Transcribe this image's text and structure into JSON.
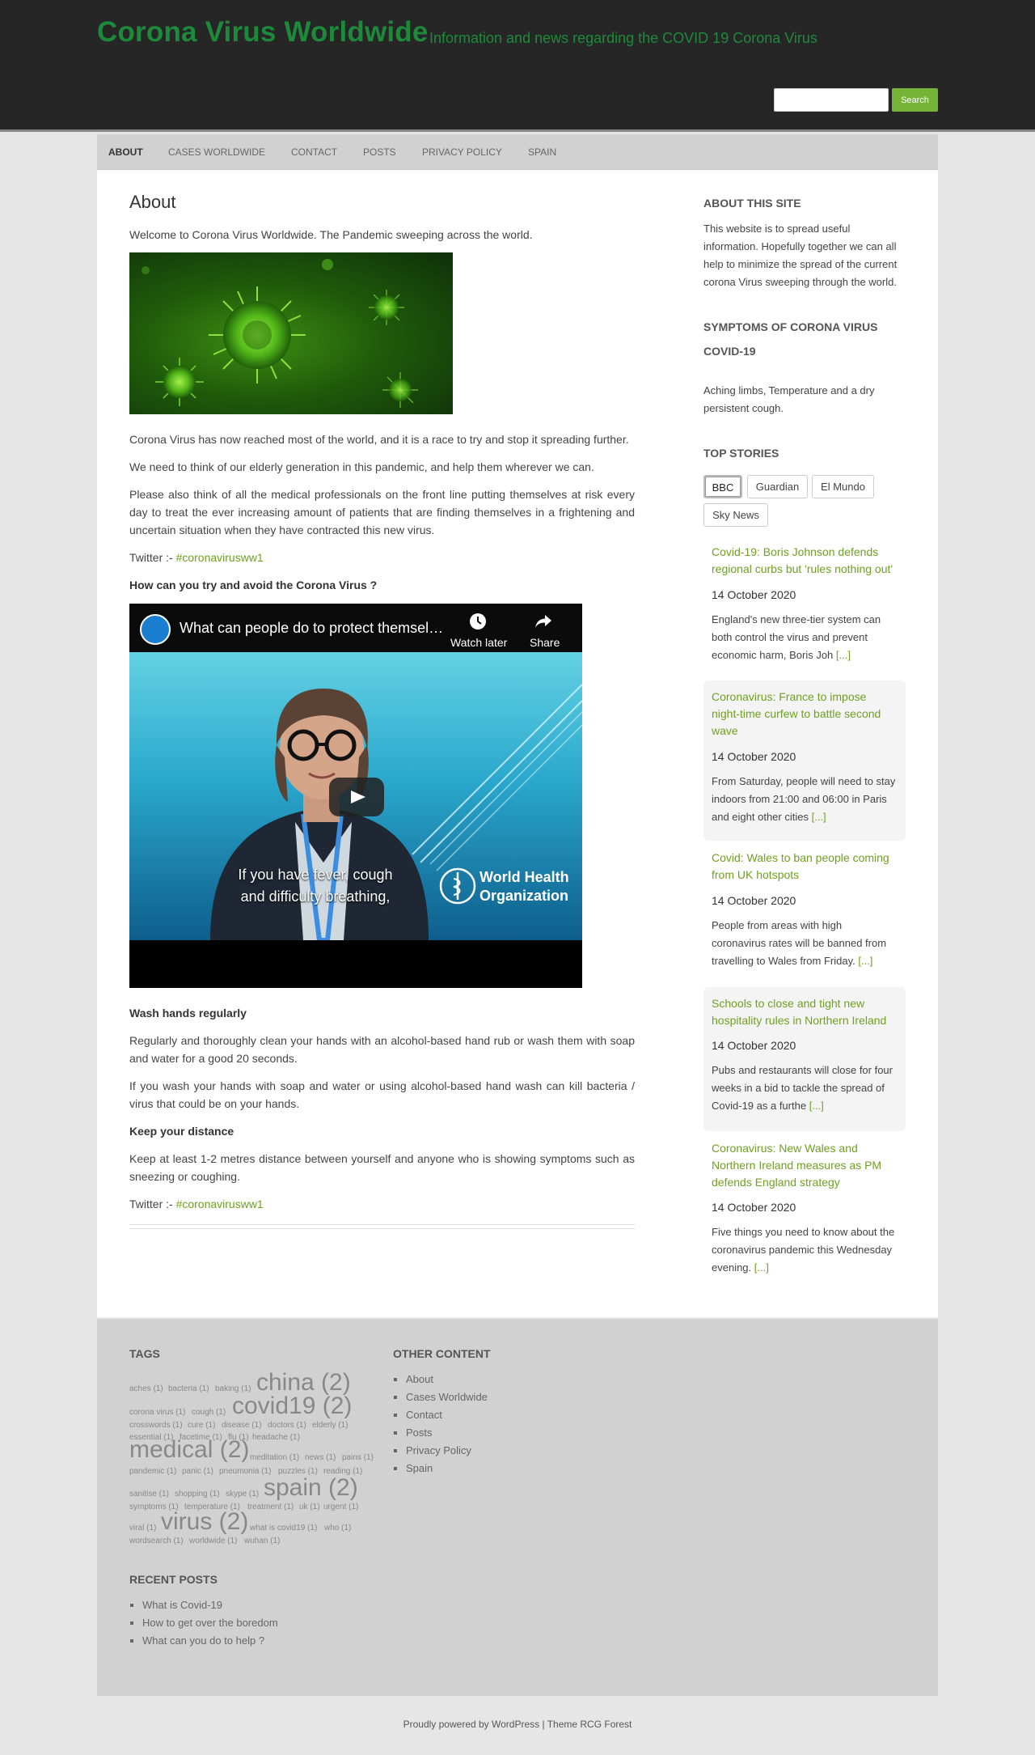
{
  "header": {
    "site_title": "Corona Virus Worldwide",
    "site_description": "Information and news regarding the COVID 19 Corona Virus",
    "search_button": "Search"
  },
  "nav": [
    "ABOUT",
    "CASES WORLDWIDE",
    "CONTACT",
    "POSTS",
    "PRIVACY POLICY",
    "SPAIN"
  ],
  "main": {
    "title": "About",
    "intro": "Welcome to Corona Virus Worldwide. The Pandemic sweeping across the world.",
    "p1": "Corona Virus has now reached most of the world, and it is a race to try and stop it spreading further.",
    "p2": "We need to think of our elderly generation in this pandemic, and help them wherever we can.",
    "p3": "Please also think of all the medical professionals on the front line putting themselves at risk every day to treat the ever increasing amount of patients that are finding themselves in a frightening and uncertain situation when they have contracted this new virus.",
    "twitter_label": "Twitter :-",
    "twitter_handle": "#coronavirusww1",
    "avoid_heading": "How can you try and avoid the Corona Virus ?",
    "video": {
      "title": "What can people do to protect themsel…",
      "watch_later": "Watch later",
      "share": "Share",
      "caption_line1": "If you have fever, cough",
      "caption_line2": "and difficulty breathing,",
      "org_line1": "World Health",
      "org_line2": "Organization"
    },
    "wash_heading": "Wash hands regularly",
    "wash_p1": "Regularly and thoroughly clean your hands with an alcohol-based hand rub or wash them with soap and water for a good 20 seconds.",
    "wash_p2": "If you wash your hands with soap and water or using alcohol-based hand wash can kill bacteria / virus that could be on your hands.",
    "distance_heading": "Keep your distance",
    "distance_p": "Keep at least 1-2 metres distance between yourself and anyone who is showing symptoms such as sneezing or coughing.",
    "twitter_label2": "Twitter :-",
    "twitter_handle2": "#coronavirusww1"
  },
  "sidebar": {
    "about_title": "ABOUT THIS SITE",
    "about_text": "This website is to spread useful information. Hopefully together we can all help to minimize the spread of the current corona Virus sweeping through the world.",
    "symptoms_title_1": "SYMPTOMS OF CORONA VIRUS",
    "symptoms_title_2": "COVID-19",
    "symptoms_text": "Aching limbs, Temperature and a dry persistent cough.",
    "stories_title": "TOP STORIES",
    "tabs": [
      "BBC",
      "Guardian",
      "El Mundo",
      "Sky News"
    ],
    "more": "[...]",
    "stories": [
      {
        "title": "Covid-19: Boris Johnson defends regional curbs but 'rules nothing out'",
        "date": "14 October 2020",
        "text": "England's new three-tier system can both control the virus and prevent economic harm, Boris Joh"
      },
      {
        "title": "Coronavirus: France to impose night-time curfew to battle second wave",
        "date": "14 October 2020",
        "text": "From Saturday, people will need to stay indoors from 21:00 and 06:00 in Paris and eight other cities"
      },
      {
        "title": "Covid: Wales to ban people coming from UK hotspots",
        "date": "14 October 2020",
        "text": "People from areas with high coronavirus rates will be banned from travelling to Wales from Friday."
      },
      {
        "title": "Schools to close and tight new hospitality rules in Northern Ireland",
        "date": "14 October 2020",
        "text": "Pubs and restaurants will close for four weeks in a bid to tackle the spread of Covid-19 as a furthe"
      },
      {
        "title": "Coronavirus: New Wales and Northern Ireland measures as PM defends England strategy",
        "date": "14 October 2020",
        "text": "Five things you need to know about the coronavirus pandemic this Wednesday evening."
      }
    ]
  },
  "footer": {
    "tags_title": "TAGS",
    "tags": [
      "aches (1)",
      "bacteria (1)",
      "baking (1)",
      "china (2)",
      "corona virus (1)",
      "cough (1)",
      "covid19 (2)",
      "crosswords (1)",
      "cure (1)",
      "disease (1)",
      "doctors (1)",
      "elderly (1)",
      "essential (1)",
      "facetime (1)",
      "flu (1)",
      "headache (1)",
      "medical (2)",
      "meditation (1)",
      "news (1)",
      "pains (1)",
      "pandemic (1)",
      "panic (1)",
      "pneumonia (1)",
      "puzzles (1)",
      "reading (1)",
      "sanitise (1)",
      "shopping (1)",
      "skype (1)",
      "spain (2)",
      "symptoms (1)",
      "temperature (1)",
      "treatment (1)",
      "uk (1)",
      "urgent (1)",
      "viral (1)",
      "virus (2)",
      "what is covid19 (1)",
      "who (1)",
      "wordsearch (1)",
      "worldwide (1)",
      "wuhan (1)"
    ],
    "other_title": "OTHER CONTENT",
    "other_links": [
      "About",
      "Cases Worldwide",
      "Contact",
      "Posts",
      "Privacy Policy",
      "Spain"
    ],
    "recent_title": "RECENT POSTS",
    "recent_links": [
      "What is Covid-19",
      "How to get over the boredom",
      "What can you do to help ?"
    ],
    "credits": "Proudly powered by WordPress | Theme RCG Forest"
  },
  "colors": {
    "accent_green": "#1d8a3b",
    "link_green": "#6fa022",
    "search_button": "#75b436",
    "header_bg": "#262626"
  }
}
